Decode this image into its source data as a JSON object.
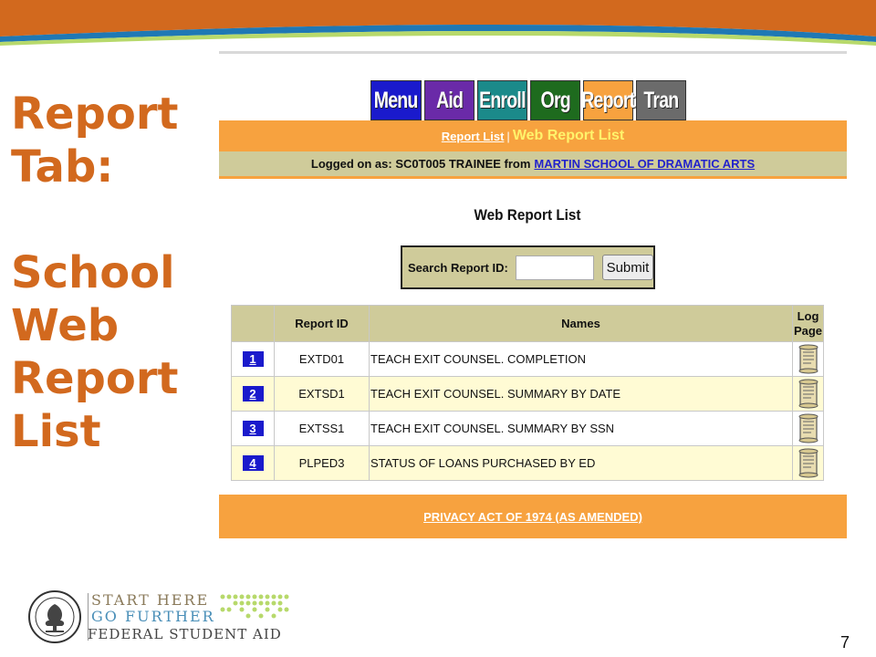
{
  "slide": {
    "title_line1": "Report",
    "title_line2": "Tab:",
    "title_line3": "School",
    "title_line4": "Web",
    "title_line5": "Report",
    "title_line6": "List",
    "page_number": "7"
  },
  "tabs": [
    {
      "label": "Menu",
      "color": "#1a1acc"
    },
    {
      "label": "Aid",
      "color": "#6a2aa8"
    },
    {
      "label": "Enroll",
      "color": "#1b8a8a"
    },
    {
      "label": "Org",
      "color": "#1e6b1e"
    },
    {
      "label": "Report",
      "color": "#f7a23f"
    },
    {
      "label": "Tran",
      "color": "#6b6b6b"
    }
  ],
  "nav": {
    "report_list_link": "Report List",
    "separator": "|",
    "current": "Web Report List"
  },
  "login": {
    "text": "Logged on as: SC0T005 TRAINEE from",
    "school": "MARTIN SCHOOL OF DRAMATIC ARTS"
  },
  "heading": "Web Report List",
  "search": {
    "label": "Search Report ID:",
    "value": "",
    "button": "Submit"
  },
  "table": {
    "headers": {
      "num": "",
      "report_id": "Report ID",
      "names": "Names",
      "log_line1": "Log",
      "log_line2": "Page"
    },
    "rows": [
      {
        "num": "1",
        "report_id": "EXTD01",
        "name": "TEACH EXIT COUNSEL. COMPLETION"
      },
      {
        "num": "2",
        "report_id": "EXTSD1",
        "name": "TEACH EXIT COUNSEL. SUMMARY BY DATE"
      },
      {
        "num": "3",
        "report_id": "EXTSS1",
        "name": "TEACH EXIT COUNSEL. SUMMARY BY SSN"
      },
      {
        "num": "4",
        "report_id": "PLPED3",
        "name": "STATUS OF LOANS PURCHASED BY ED"
      }
    ]
  },
  "footer": {
    "link": "PRIVACY ACT OF 1974 (AS AMENDED)"
  },
  "logo": {
    "line1": "START HERE",
    "line2": "GO FURTHER",
    "line3": "FEDERAL STUDENT AID"
  },
  "colors": {
    "title": "#d2691e",
    "accent_orange": "#f7a23f",
    "olive": "#cfcb9a",
    "row_alt": "#fffbd4",
    "link_blue": "#2222cc"
  }
}
